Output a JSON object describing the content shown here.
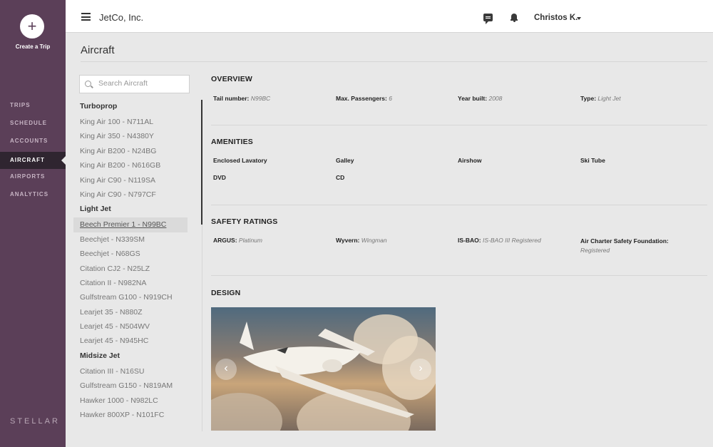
{
  "sidebar": {
    "create_label": "Create a Trip",
    "create_icon": "+",
    "nav": [
      "TRIPS",
      "SCHEDULE",
      "ACCOUNTS",
      "AIRCRAFT",
      "AIRPORTS",
      "ANALYTICS"
    ],
    "active": "AIRCRAFT",
    "logo": "STELLAR"
  },
  "header": {
    "company": "JetCo, Inc.",
    "user": "Christos K."
  },
  "page": {
    "title": "Aircraft"
  },
  "search": {
    "placeholder": "Search Aircraft"
  },
  "aircraft_groups": [
    {
      "name": "Turboprop",
      "items": [
        "King Air 100 - N711AL",
        "King Air 350 - N4380Y",
        "King Air B200 - N24BG",
        "King Air B200 - N616GB",
        "King Air C90 - N119SA",
        "King Air C90 - N797CF"
      ]
    },
    {
      "name": "Light Jet",
      "items": [
        "Beech Premier 1 - N99BC",
        "Beechjet - N339SM",
        "Beechjet - N68GS",
        "Citation CJ2 - N25LZ",
        "Citation II - N982NA",
        "Gulfstream G100 - N919CH",
        "Learjet 35 - N880Z",
        "Learjet 45 - N504WV",
        "Learjet 45 - N945HC"
      ]
    },
    {
      "name": "Midsize Jet",
      "items": [
        "Citation III - N16SU",
        "Gulfstream G150 - N819AM",
        "Hawker 1000 - N982LC",
        "Hawker 800XP - N101FC"
      ]
    }
  ],
  "selected_aircraft": "Beech Premier 1 - N99BC",
  "overview": {
    "heading": "OVERVIEW",
    "tail_label": "Tail number:",
    "tail_value": "N99BC",
    "pax_label": "Max. Passengers:",
    "pax_value": "6",
    "year_label": "Year built:",
    "year_value": "2008",
    "type_label": "Type:",
    "type_value": "Light Jet"
  },
  "amenities": {
    "heading": "AMENITIES",
    "items": [
      "Enclosed Lavatory",
      "Galley",
      "Airshow",
      "Ski Tube",
      "DVD",
      "CD"
    ]
  },
  "safety": {
    "heading": "SAFETY RATINGS",
    "argus_label": "ARGUS:",
    "argus_value": "Platinum",
    "wyvern_label": "Wyvern:",
    "wyvern_value": "Wingman",
    "isbao_label": "IS-BAO:",
    "isbao_value": "IS-BAO III Registered",
    "acsf_label": "Air Charter Safety Foundation:",
    "acsf_value": "Registered"
  },
  "design": {
    "heading": "DESIGN",
    "prev_icon": "‹",
    "next_icon": "›"
  }
}
